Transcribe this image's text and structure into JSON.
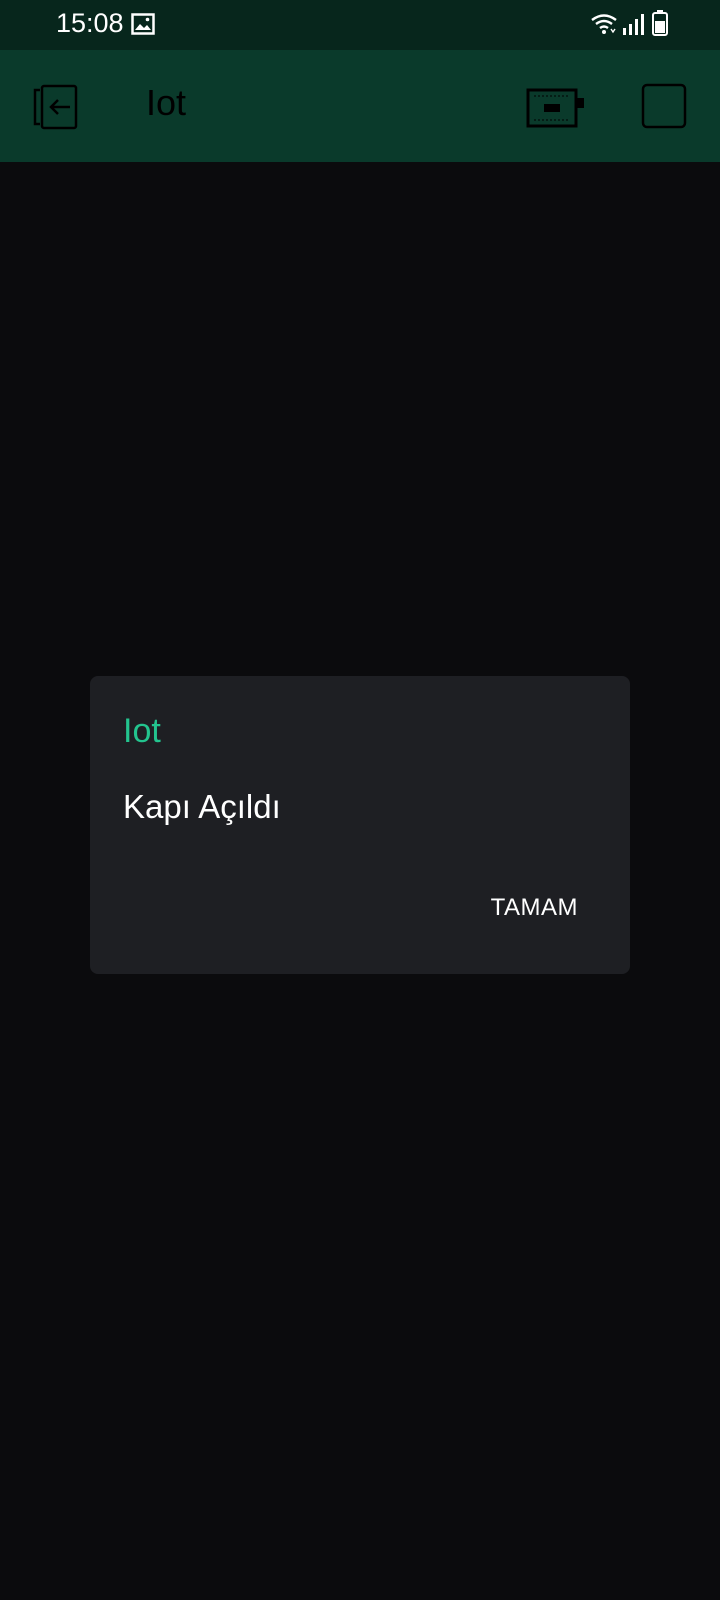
{
  "status_bar": {
    "time": "15:08",
    "icons": [
      "gallery-icon",
      "wifi-icon",
      "signal-icon",
      "battery-icon"
    ]
  },
  "app_bar": {
    "title": "Iot",
    "icons": [
      "exit-icon",
      "device-icon",
      "square-icon"
    ]
  },
  "dialog": {
    "title": "Iot",
    "message": "Kapı Açıldı",
    "ok_label": "TAMAM"
  },
  "colors": {
    "status_bar_bg": "#07261c",
    "app_bar_bg": "#0a3a2b",
    "content_bg": "#0b0b0d",
    "dialog_bg": "#1e1f23",
    "accent": "#23c48e"
  }
}
